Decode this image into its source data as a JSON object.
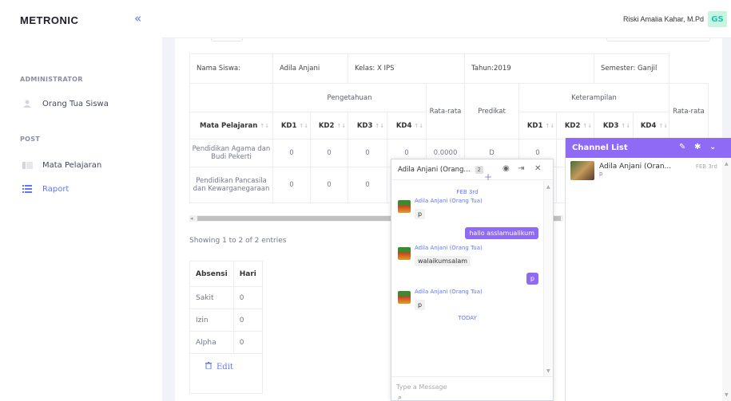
{
  "brand": "METRONIC",
  "colors": {
    "accent": "#5d78ff",
    "chat_purple": "#8f6bf5",
    "avatar_bg": "#c8f5e0"
  },
  "sidebar": {
    "sections": [
      {
        "title": "ADMINISTRATOR",
        "items": [
          {
            "label": "Orang Tua Siswa",
            "icon": "user-icon"
          }
        ]
      },
      {
        "title": "POST",
        "items": [
          {
            "label": "Mata Pelajaran",
            "icon": "folder-icon"
          },
          {
            "label": "Raport",
            "icon": "list-icon",
            "active": true
          }
        ]
      }
    ]
  },
  "header": {
    "user_name": "Riski Amalia Kahar, M.Pd",
    "avatar_initials": "GS"
  },
  "grade_table": {
    "info": {
      "nama": "Nama Siswa:",
      "nama_value": "Adila Anjani",
      "kelas": "Kelas: X IPS",
      "tahun": "Tahun:2019",
      "semester": "Semester: Ganjil"
    },
    "group_headers": {
      "pengetahuan": "Pengetahuan",
      "rata": "Rata-rata",
      "predikat": "Predikat",
      "keterampilan": "Keterampilan",
      "rata2": "Rata-rata"
    },
    "columns": [
      "Mata Pelajaran",
      "KD1",
      "KD2",
      "KD3",
      "KD4",
      "KD1",
      "KD2",
      "KD3",
      "KD4"
    ],
    "rows": [
      {
        "mapel": "Pendidikan Agama dan Budi Pekerti",
        "kd1": "0",
        "kd2": "0",
        "kd3": "0",
        "kd4": "0",
        "rata": "0.0000",
        "predikat": "D",
        "k_kd1": "0"
      },
      {
        "mapel": "Pendidikan Pancasila dan Kewarganegaraan",
        "kd1": "0",
        "kd2": "0",
        "kd3": "0"
      }
    ]
  },
  "showing": "Showing 1 to 2 of 2 entries",
  "absensi": {
    "headers": [
      "Absensi",
      "Hari"
    ],
    "rows": [
      {
        "label": "Sakit",
        "value": "0"
      },
      {
        "label": "Izin",
        "value": "0"
      },
      {
        "label": "Alpha",
        "value": "0"
      }
    ],
    "edit_label": "Edit"
  },
  "chat": {
    "title": "Adila Anjani (Orang...",
    "badge": "2",
    "date1": "FEB 3rd",
    "messages": [
      {
        "sender": "Adila Anjani (Orang Tua)",
        "text": "p"
      },
      {
        "text": "hallo asslamualikum"
      },
      {
        "sender": "Adila Anjani (Orang Tua)",
        "text": "walaikumsalam"
      },
      {
        "text": "p"
      },
      {
        "sender": "Adila Anjani (Orang Tua)",
        "text": "p"
      }
    ],
    "date2": "TODAY",
    "input_placeholder": "Type a Message"
  },
  "channel_list": {
    "title": "Channel List",
    "items": [
      {
        "name": "Adila Anjani (Oran...",
        "last": "p",
        "date": "FEB 3rd"
      }
    ]
  }
}
